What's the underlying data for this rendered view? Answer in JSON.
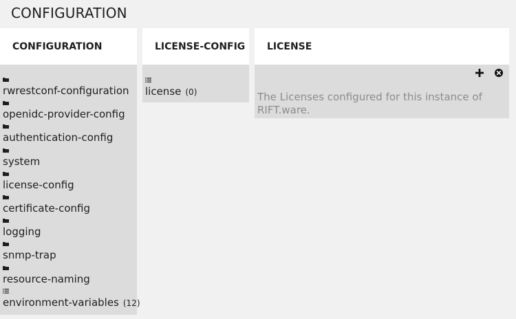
{
  "page_title": "CONFIGURATION",
  "panels": {
    "configuration": {
      "header": "CONFIGURATION",
      "items": [
        {
          "label": "rwrestconf-configuration",
          "icon": "folder-icon",
          "count": ""
        },
        {
          "label": "openidc-provider-config",
          "icon": "folder-icon",
          "count": ""
        },
        {
          "label": "authentication-config",
          "icon": "folder-icon",
          "count": ""
        },
        {
          "label": "system",
          "icon": "folder-icon",
          "count": ""
        },
        {
          "label": "license-config",
          "icon": "folder-icon",
          "count": ""
        },
        {
          "label": "certificate-config",
          "icon": "folder-icon",
          "count": ""
        },
        {
          "label": "logging",
          "icon": "folder-icon",
          "count": ""
        },
        {
          "label": "snmp-trap",
          "icon": "folder-icon",
          "count": ""
        },
        {
          "label": "resource-naming",
          "icon": "folder-icon",
          "count": ""
        },
        {
          "label": "environment-variables",
          "icon": "list-icon",
          "count": "(12)"
        }
      ]
    },
    "license_config": {
      "header": "LICENSE-CONFIG",
      "items": [
        {
          "label": "license",
          "icon": "list-icon",
          "count": "(0)"
        }
      ]
    },
    "license": {
      "header": "LICENSE",
      "description": "The Licenses configured for this instance of RIFT.ware.",
      "actions": [
        "add-icon",
        "remove-icon"
      ]
    }
  },
  "colors": {
    "background": "#f1f1f1",
    "panel_header": "#ffffff",
    "panel_body": "#dcdcdc",
    "description_text": "#8c8c8c"
  }
}
